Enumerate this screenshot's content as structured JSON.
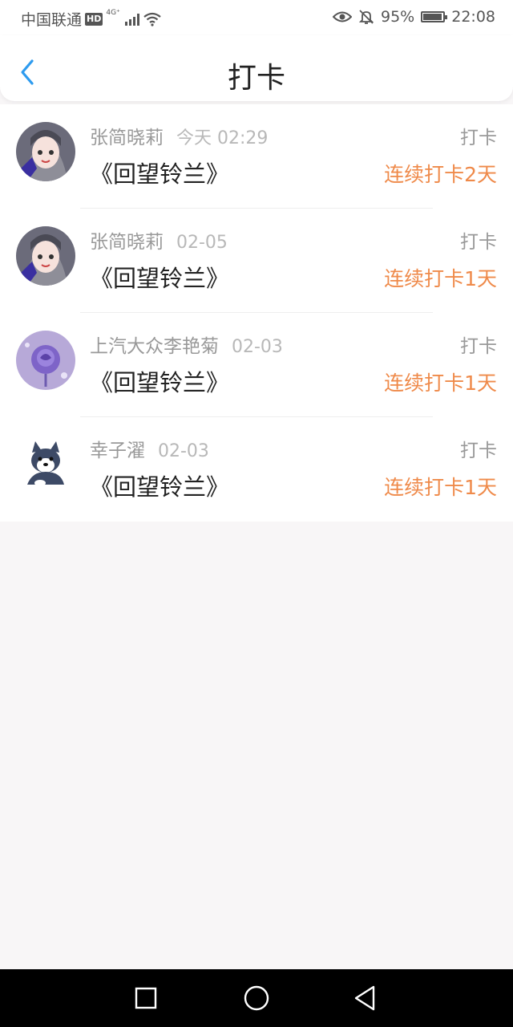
{
  "status_bar": {
    "carrier": "中国联通",
    "hd": "HD",
    "network": "4G⁺",
    "battery_percent": "95%",
    "battery_level": 0.95,
    "time": "22:08",
    "icons": [
      "signal-icon",
      "wifi-icon",
      "eye-icon",
      "bell-muted-icon",
      "battery-icon"
    ]
  },
  "header": {
    "title": "打卡",
    "back_icon": "chevron-left-icon",
    "accent_color": "#2e9bef"
  },
  "checkins": [
    {
      "name": "张简晓莉",
      "date": "今天 02:29",
      "action": "打卡",
      "book": "《回望铃兰》",
      "streak": "连续打卡2天",
      "avatar": "girl-avatar"
    },
    {
      "name": "张简晓莉",
      "date": "02-05",
      "action": "打卡",
      "book": "《回望铃兰》",
      "streak": "连续打卡1天",
      "avatar": "girl-avatar"
    },
    {
      "name": "上汽大众李艳菊",
      "date": "02-03",
      "action": "打卡",
      "book": "《回望铃兰》",
      "streak": "连续打卡1天",
      "avatar": "purple-rose-avatar"
    },
    {
      "name": "幸子濯",
      "date": "02-03",
      "action": "打卡",
      "book": "《回望铃兰》",
      "streak": "连续打卡1天",
      "avatar": "husky-avatar"
    }
  ],
  "colors": {
    "streak": "#ef8a4a",
    "background": "#f8f6f7"
  },
  "nav_bar": {
    "buttons": [
      "recent-apps-icon",
      "home-icon",
      "back-triangle-icon"
    ]
  }
}
